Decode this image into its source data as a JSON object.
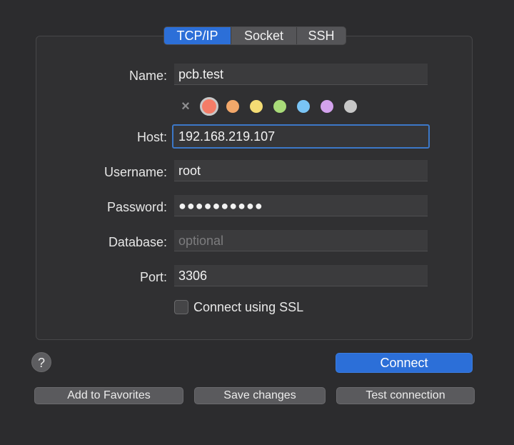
{
  "tabs": [
    {
      "label": "TCP/IP",
      "active": true
    },
    {
      "label": "Socket",
      "active": false
    },
    {
      "label": "SSH",
      "active": false
    }
  ],
  "form": {
    "name": {
      "label": "Name:",
      "value": "pcb.test"
    },
    "colors": {
      "clear_icon": "×",
      "swatches": [
        "#f47c67",
        "#f3a86a",
        "#f4dc74",
        "#a9db79",
        "#79c4f5",
        "#d3a2ed",
        "#c7c7c7"
      ],
      "selected_index": 0
    },
    "host": {
      "label": "Host:",
      "value": "192.168.219.107"
    },
    "username": {
      "label": "Username:",
      "value": "root"
    },
    "password": {
      "label": "Password:",
      "value": "●●●●●●●●●●"
    },
    "database": {
      "label": "Database:",
      "placeholder": "optional"
    },
    "port": {
      "label": "Port:",
      "value": "3306"
    },
    "ssl": {
      "label": "Connect using SSL",
      "checked": false
    }
  },
  "help": {
    "label": "?"
  },
  "buttons": {
    "connect": "Connect",
    "add_favorites": "Add to Favorites",
    "save_changes": "Save changes",
    "test_connection": "Test connection"
  },
  "colors": {
    "accent": "#2c6fd8",
    "background": "#2c2c2e",
    "focus_ring": "#3c78c8"
  }
}
